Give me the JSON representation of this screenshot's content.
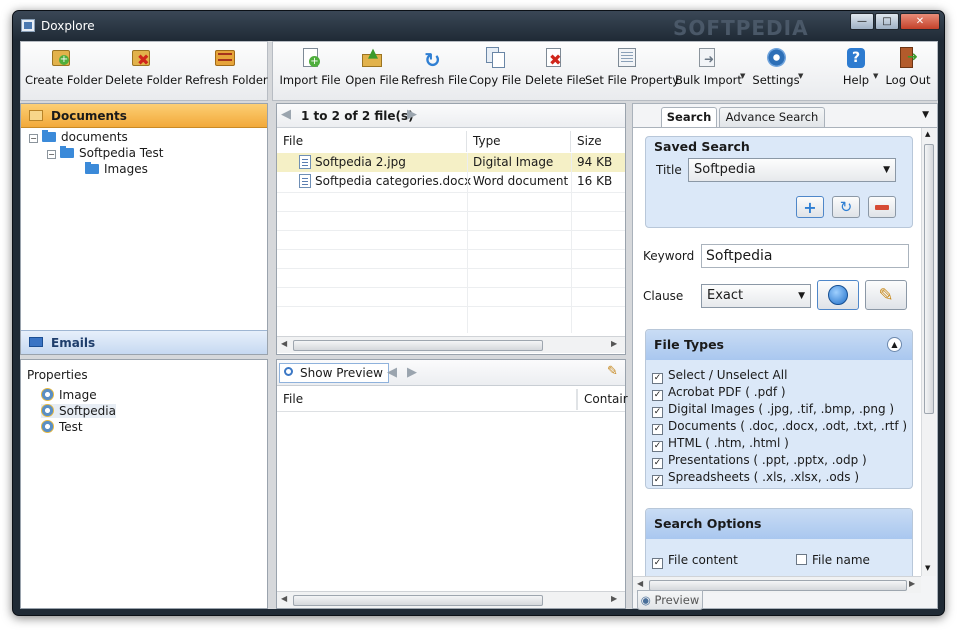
{
  "window": {
    "title": "Doxplore",
    "watermark": "SOFTPEDIA"
  },
  "left_toolbar": [
    {
      "label": "Create Folder",
      "icon": "create-folder-icon"
    },
    {
      "label": "Delete Folder",
      "icon": "delete-folder-icon"
    },
    {
      "label": "Refresh Folder",
      "icon": "refresh-folder-icon"
    }
  ],
  "main_toolbar": {
    "import": "Import File",
    "open": "Open File",
    "refresh": "Refresh File",
    "copy": "Copy File",
    "delete": "Delete File",
    "set_property": "Set File Property",
    "bulk_import": "Bulk Import",
    "settings": "Settings",
    "help": "Help",
    "logout": "Log Out"
  },
  "nav": {
    "documents_header": "Documents",
    "emails_header": "Emails",
    "tree": [
      "documents",
      "Softpedia Test",
      "Images"
    ]
  },
  "properties": {
    "header": "Properties",
    "items": [
      "Image",
      "Softpedia",
      "Test"
    ]
  },
  "files": {
    "pager": "1 to 2 of 2 file(s)",
    "columns": [
      "File",
      "Type",
      "Size"
    ],
    "rows": [
      {
        "name": "Softpedia 2.jpg",
        "type": "Digital Image",
        "size": "94 KB"
      },
      {
        "name": "Softpedia categories.docx",
        "type": "Word document",
        "size": "16 KB"
      }
    ]
  },
  "preview": {
    "show_preview": "Show Preview",
    "columns": [
      "File",
      "Contair"
    ],
    "tab": "Preview"
  },
  "search": {
    "tabs": [
      "Search",
      "Advance Search"
    ],
    "saved_search": {
      "header": "Saved Search",
      "title_label": "Title",
      "title_value": "Softpedia"
    },
    "keyword_label": "Keyword",
    "keyword_value": "Softpedia",
    "clause_label": "Clause",
    "clause_value": "Exact",
    "file_types_header": "File Types",
    "file_types": [
      "Select / Unselect  All",
      "Acrobat PDF ( .pdf )",
      "Digital Images ( .jpg, .tif, .bmp, .png )",
      "Documents ( .doc, .docx, .odt, .txt, .rtf )",
      "HTML ( .htm, .html )",
      "Presentations ( .ppt, .pptx, .odp )",
      "Spreadsheets ( .xls, .xlsx, .ods )"
    ],
    "search_options_header": "Search Options",
    "opt_content": "File content",
    "opt_name": "File name"
  },
  "colors": {
    "accent": "#f5b94a",
    "selection": "#f5f0c6",
    "panel_blue": "#dbe8f8"
  }
}
